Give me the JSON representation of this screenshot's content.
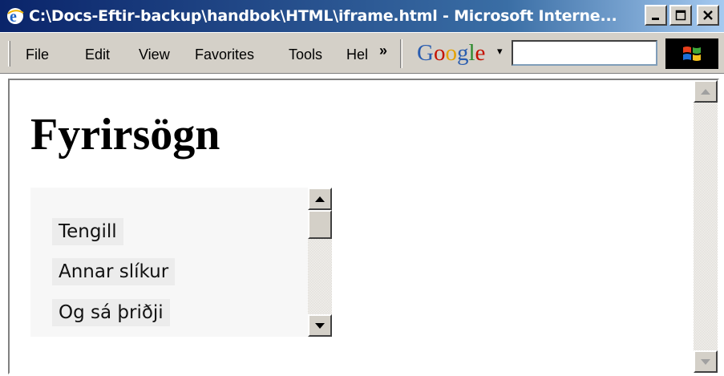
{
  "window": {
    "title": "C:\\Docs-Eftir-backup\\handbok\\HTML\\iframe.html - Microsoft Interne...",
    "icon": "ie-icon"
  },
  "window_buttons": [
    {
      "name": "minimize-button",
      "icon": "minimize-icon"
    },
    {
      "name": "maximize-button",
      "icon": "maximize-icon"
    },
    {
      "name": "close-button",
      "icon": "close-icon"
    }
  ],
  "menu": {
    "items": [
      "File",
      "Edit",
      "View",
      "Favorites",
      "Tools",
      "Hel"
    ],
    "overflow": "»"
  },
  "google_toolbar": {
    "logo": {
      "letters": [
        "G",
        "o",
        "o",
        "g",
        "l",
        "e"
      ],
      "colors": [
        "#2a5db0",
        "#c41200",
        "#e5a100",
        "#2a5db0",
        "#2e8b2e",
        "#c41200"
      ]
    },
    "dropdown": "▾",
    "search_value": ""
  },
  "page": {
    "heading": "Fyrirsögn",
    "iframe_links": [
      "Tengill",
      "Annar slíkur",
      "Og sá þriðji"
    ]
  },
  "colors": {
    "title_bar_start": "#0a246a",
    "title_bar_end": "#a6caf0",
    "chrome": "#d4d0c8"
  }
}
